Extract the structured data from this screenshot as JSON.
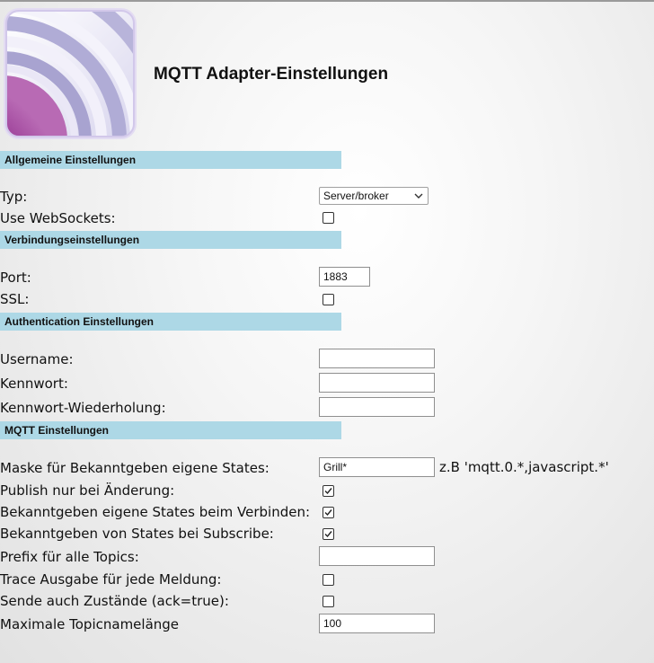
{
  "header": {
    "title": "MQTT Adapter-Einstellungen",
    "logo_icon": "mqtt-radio-waves-logo",
    "logo_colors": {
      "accent": "#8e2a8a",
      "rings": "#c2bfe0",
      "frame": "#e3dcf2"
    }
  },
  "sections": {
    "general": {
      "label": "Allgemeine Einstellungen"
    },
    "connection": {
      "label": "Verbindungseinstellungen"
    },
    "auth": {
      "label": "Authentication Einstellungen"
    },
    "mqtt": {
      "label": "MQTT Einstellungen"
    }
  },
  "section_color": "#add8e6",
  "fields": {
    "type": {
      "label": "Typ:",
      "value": "Server/broker"
    },
    "websockets": {
      "label": "Use WebSockets:",
      "checked": false
    },
    "port": {
      "label": "Port:",
      "value": "1883"
    },
    "ssl": {
      "label": "SSL:",
      "checked": false
    },
    "username": {
      "label": "Username:",
      "value": ""
    },
    "password": {
      "label": "Kennwort:",
      "value": ""
    },
    "password_repeat": {
      "label": "Kennwort-Wiederholung:",
      "value": ""
    },
    "mask": {
      "label": "Maske für Bekanntgeben eigene States:",
      "value": "Grill*",
      "hint": "z.B 'mqtt.0.*,javascript.*'"
    },
    "publish_on_change": {
      "label": "Publish nur bei Änderung:",
      "checked": true
    },
    "publish_on_connect": {
      "label": "Bekanntgeben eigene States beim Verbinden:",
      "checked": true
    },
    "publish_on_subscribe": {
      "label": "Bekanntgeben von States bei Subscribe:",
      "checked": true
    },
    "prefix": {
      "label": "Prefix für alle Topics:",
      "value": ""
    },
    "trace": {
      "label": "Trace Ausgabe für jede Meldung:",
      "checked": false
    },
    "send_ack": {
      "label": "Sende auch Zustände (ack=true):",
      "checked": false
    },
    "max_topic_length": {
      "label": "Maximale Topicnamelänge",
      "value": "100"
    }
  }
}
